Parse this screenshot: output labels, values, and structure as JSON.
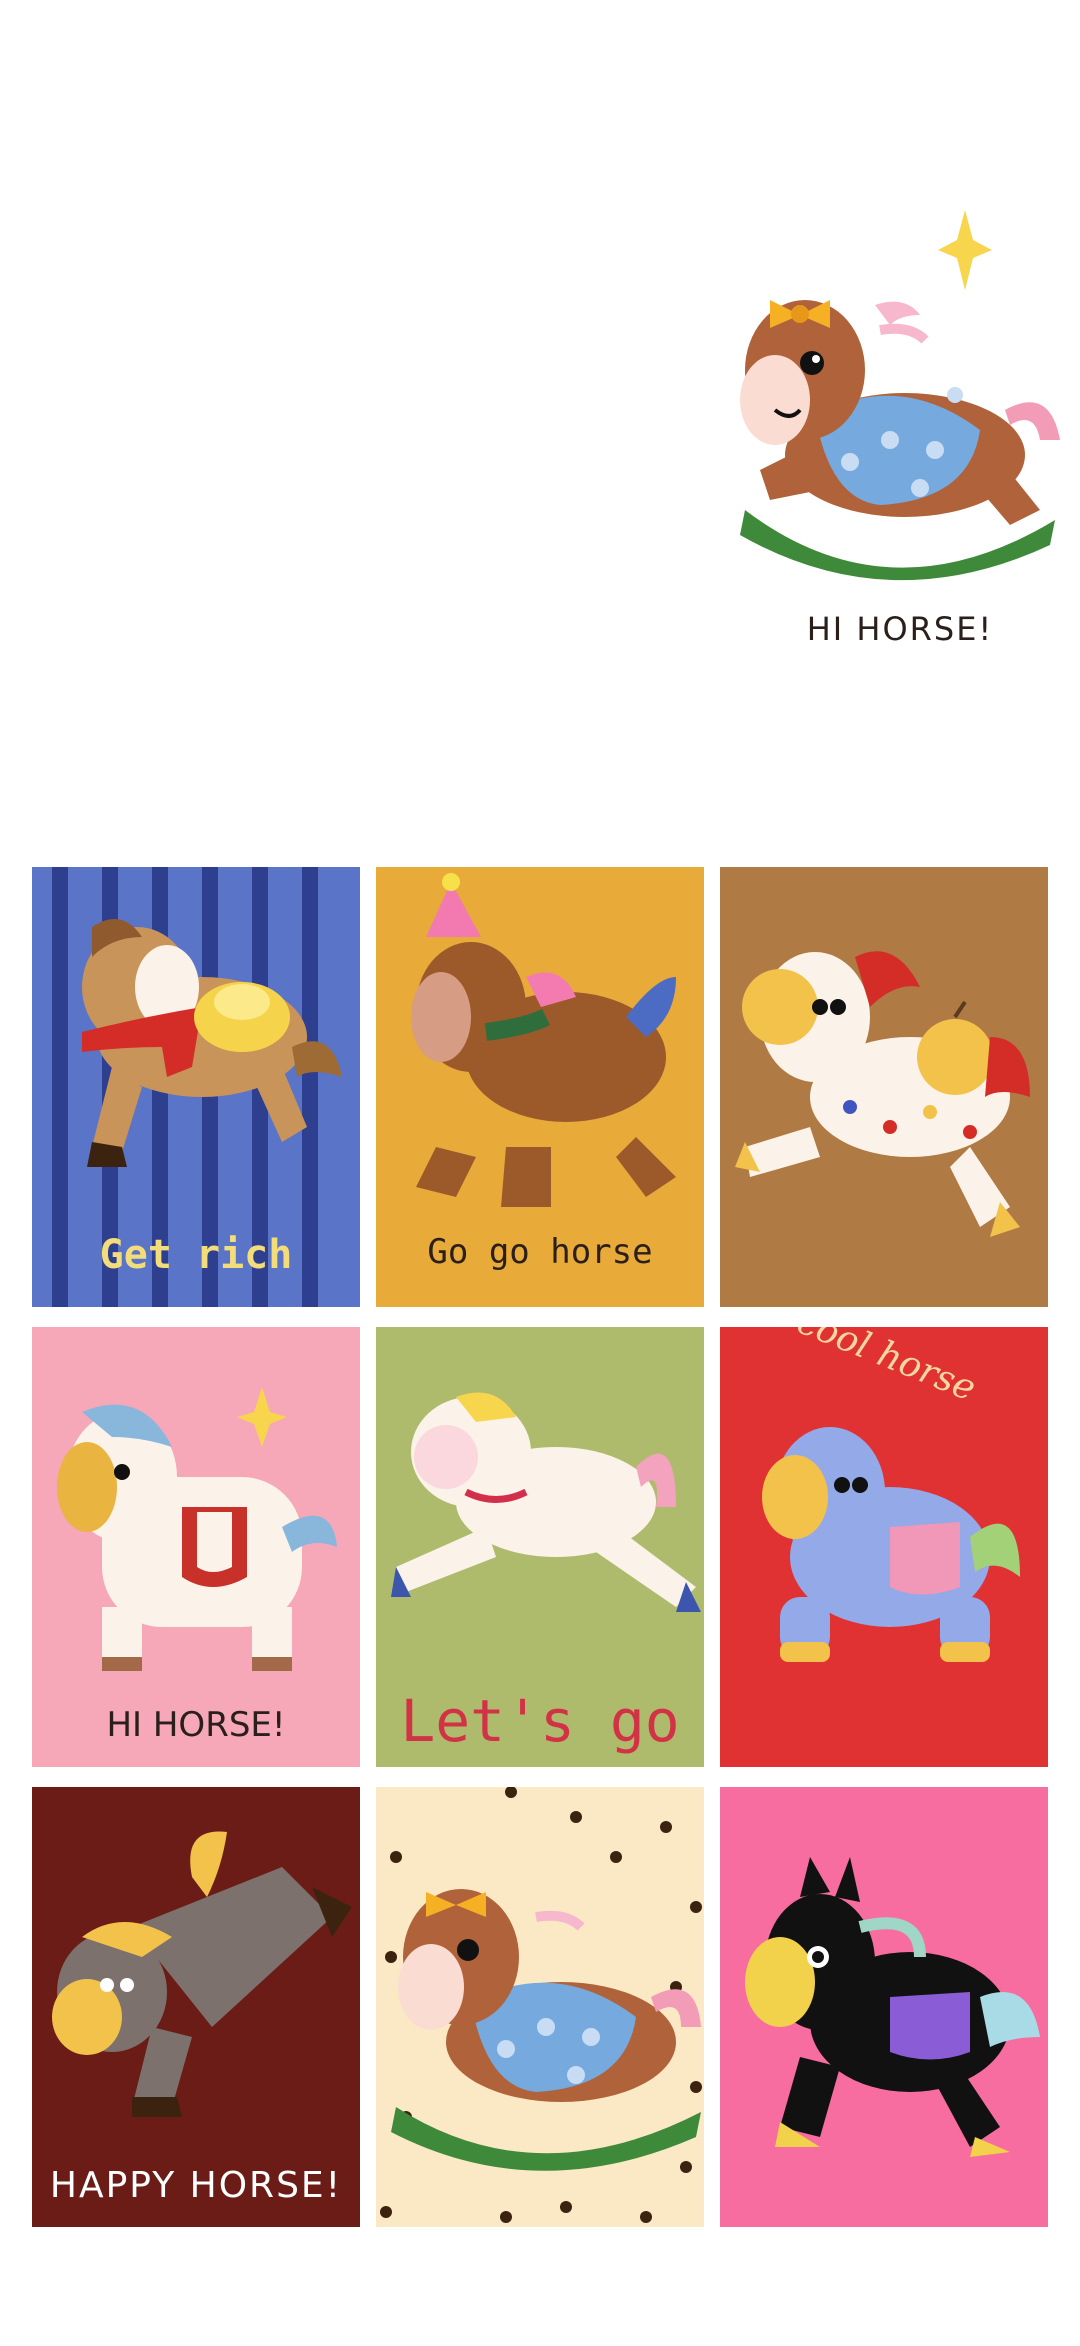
{
  "hero": {
    "caption": "HI HORSE!"
  },
  "cards": [
    {
      "caption": "Get rich",
      "bg": "#5a74c7"
    },
    {
      "caption": "Go go horse",
      "bg": "#e8aa39"
    },
    {
      "caption": "",
      "bg": "#b07a45"
    },
    {
      "caption": "HI HORSE!",
      "bg": "#f6a7b8"
    },
    {
      "caption": "Let's go",
      "bg": "#aebb6c"
    },
    {
      "caption": "cool horse",
      "bg": "#e03232"
    },
    {
      "caption": "HAPPY HORSE!",
      "bg": "#6b1c17"
    },
    {
      "caption": "",
      "bg": "#fbe9c6"
    },
    {
      "caption": "",
      "bg": "#f76da0"
    }
  ]
}
